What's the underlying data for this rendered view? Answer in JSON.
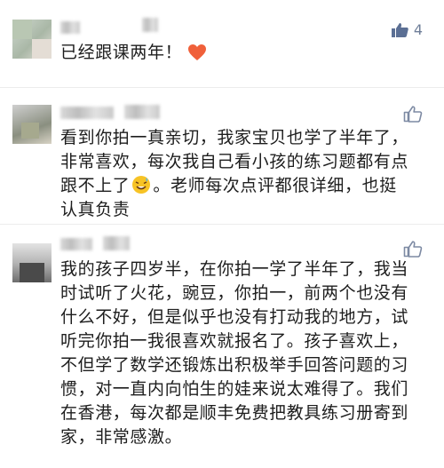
{
  "comments": [
    {
      "likes": "4",
      "lines": [
        "已经跟课两年！"
      ],
      "emoji": "heart-emoji"
    },
    {
      "likes": "",
      "lines": [
        "看到你拍一真亲切，我家宝贝也学了半年了，",
        "非常喜欢，每次我自己看小孩的练习题都有点",
        "跟不上了",
        "。老师每次点评都很详细，也挺",
        "认真负责"
      ],
      "emoji": "sweat-smile-emoji"
    },
    {
      "likes": "",
      "lines": [
        "我的孩子四岁半，在你拍一学了半年了，我当",
        "时试听了火花，豌豆，你拍一，前两个也没有",
        "什么不好，但是似乎也没有打动我的地方，试",
        "听完你拍一我很喜欢就报名了。孩子喜欢上，",
        "不但学了数学还锻炼出积极举手回答问题的习",
        "惯，对一直内向怕生的娃来说太难得了。我们",
        "在香港，每次都是顺丰免费把教具练习册寄到",
        "家，非常感激。"
      ]
    }
  ],
  "colors": {
    "like_active": "#5b6f94",
    "like_idle": "#7d8aa3",
    "heart": "#f0603a"
  }
}
